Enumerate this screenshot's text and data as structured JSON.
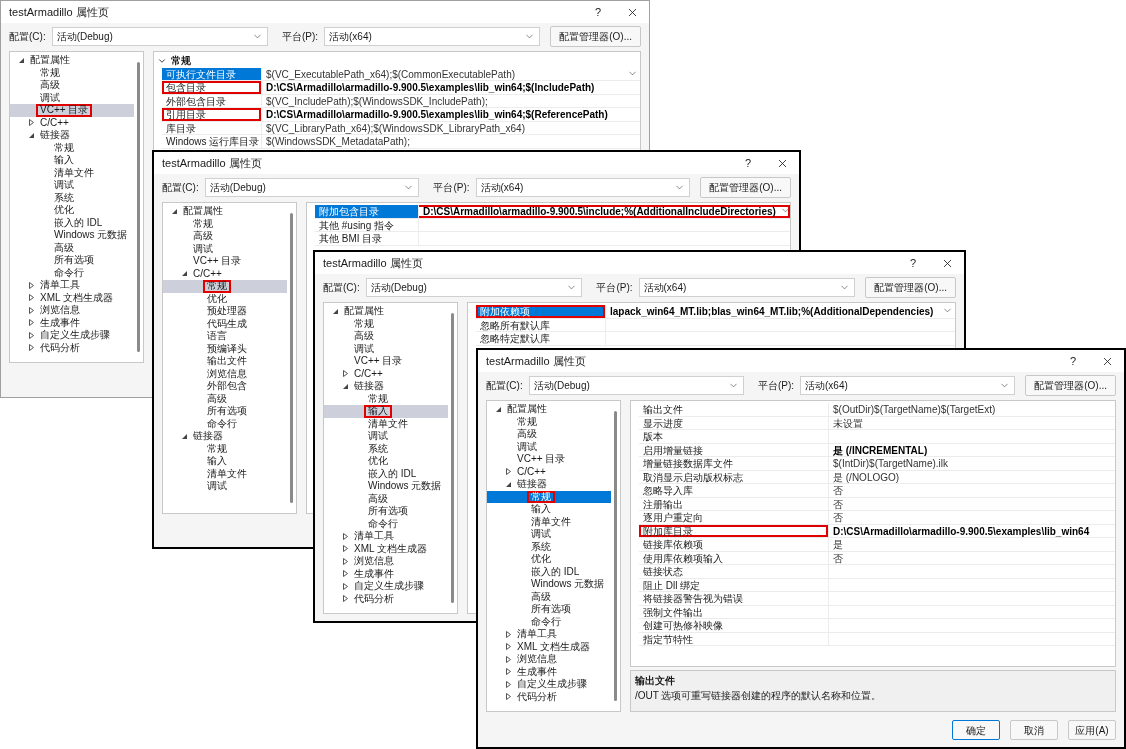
{
  "windows": [
    {
      "title": "testArmadillo 属性页",
      "help": "?",
      "active": false,
      "config_label": "配置(C):",
      "config_value": "活动(Debug)",
      "platform_label": "平台(P):",
      "platform_value": "活动(x64)",
      "manager_button": "配置管理器(O)...",
      "tree": [
        {
          "label": "配置属性",
          "expanded": true,
          "selected": false,
          "highlighted": false,
          "children": [
            {
              "label": "常规",
              "selected": false,
              "highlighted": false
            },
            {
              "label": "高级",
              "selected": false,
              "highlighted": false
            },
            {
              "label": "调试",
              "selected": false,
              "highlighted": false
            },
            {
              "label": "VC++ 目录",
              "selected": true,
              "highlighted": true
            },
            {
              "label": "C/C++",
              "expanded": false,
              "selected": false,
              "highlighted": false
            },
            {
              "label": "链接器",
              "expanded": true,
              "selected": false,
              "highlighted": false,
              "children": [
                {
                  "label": "常规",
                  "selected": false,
                  "highlighted": false
                },
                {
                  "label": "输入",
                  "selected": false,
                  "highlighted": false
                },
                {
                  "label": "清单文件",
                  "selected": false,
                  "highlighted": false
                },
                {
                  "label": "调试",
                  "selected": false,
                  "highlighted": false
                },
                {
                  "label": "系统",
                  "selected": false,
                  "highlighted": false
                },
                {
                  "label": "优化",
                  "selected": false,
                  "highlighted": false
                },
                {
                  "label": "嵌入的 IDL",
                  "selected": false,
                  "highlighted": false
                },
                {
                  "label": "Windows 元数据",
                  "selected": false,
                  "highlighted": false
                },
                {
                  "label": "高级",
                  "selected": false,
                  "highlighted": false
                },
                {
                  "label": "所有选项",
                  "selected": false,
                  "highlighted": false
                },
                {
                  "label": "命令行",
                  "selected": false,
                  "highlighted": false
                }
              ]
            },
            {
              "label": "清单工具",
              "expanded": false,
              "selected": false,
              "highlighted": false
            },
            {
              "label": "XML 文档生成器",
              "expanded": false,
              "selected": false,
              "highlighted": false
            },
            {
              "label": "浏览信息",
              "expanded": false,
              "selected": false,
              "highlighted": false
            },
            {
              "label": "生成事件",
              "expanded": false,
              "selected": false,
              "highlighted": false
            },
            {
              "label": "自定义生成步骤",
              "expanded": false,
              "selected": false,
              "highlighted": false
            },
            {
              "label": "代码分析",
              "expanded": false,
              "selected": false,
              "highlighted": false
            }
          ]
        }
      ],
      "grid": {
        "group": {
          "label": "常规",
          "expanded": true
        },
        "rows": [
          {
            "name": "可执行文件目录",
            "value": "$(VC_ExecutablePath_x64);$(CommonExecutablePath)",
            "bold": false,
            "selected": true,
            "highlighted": false
          },
          {
            "name": "包含目录",
            "value": "D:\\CS\\Armadillo\\armadillo-9.900.5\\examples\\lib_win64;$(IncludePath)",
            "bold": true,
            "selected": false,
            "highlighted": true
          },
          {
            "name": "外部包含目录",
            "value": "$(VC_IncludePath);$(WindowsSDK_IncludePath);",
            "bold": false,
            "selected": false,
            "highlighted": false
          },
          {
            "name": "引用目录",
            "value": "D:\\CS\\Armadillo\\armadillo-9.900.5\\examples\\lib_win64;$(ReferencePath)",
            "bold": true,
            "selected": false,
            "highlighted": true
          },
          {
            "name": "库目录",
            "value": "$(VC_LibraryPath_x64);$(WindowsSDK_LibraryPath_x64)",
            "bold": false,
            "selected": false,
            "highlighted": false
          },
          {
            "name": "Windows 运行库目录",
            "value": "$(WindowsSDK_MetadataPath);",
            "bold": false,
            "selected": false,
            "highlighted": false
          }
        ]
      }
    },
    {
      "title": "testArmadillo 属性页",
      "help": "?",
      "active": false,
      "config_label": "配置(C):",
      "config_value": "活动(Debug)",
      "platform_label": "平台(P):",
      "platform_value": "活动(x64)",
      "manager_button": "配置管理器(O)...",
      "tree": [
        {
          "label": "配置属性",
          "expanded": true,
          "selected": false,
          "highlighted": false,
          "children": [
            {
              "label": "常规",
              "selected": false,
              "highlighted": false
            },
            {
              "label": "高级",
              "selected": false,
              "highlighted": false
            },
            {
              "label": "调试",
              "selected": false,
              "highlighted": false
            },
            {
              "label": "VC++ 目录",
              "selected": false,
              "highlighted": false
            },
            {
              "label": "C/C++",
              "expanded": true,
              "selected": false,
              "highlighted": false,
              "children": [
                {
                  "label": "常规",
                  "selected": true,
                  "highlighted": true
                },
                {
                  "label": "优化",
                  "selected": false,
                  "highlighted": false
                },
                {
                  "label": "预处理器",
                  "selected": false,
                  "highlighted": false
                },
                {
                  "label": "代码生成",
                  "selected": false,
                  "highlighted": false
                },
                {
                  "label": "语言",
                  "selected": false,
                  "highlighted": false
                },
                {
                  "label": "预编译头",
                  "selected": false,
                  "highlighted": false
                },
                {
                  "label": "输出文件",
                  "selected": false,
                  "highlighted": false
                },
                {
                  "label": "浏览信息",
                  "selected": false,
                  "highlighted": false
                },
                {
                  "label": "外部包含",
                  "selected": false,
                  "highlighted": false
                },
                {
                  "label": "高级",
                  "selected": false,
                  "highlighted": false
                },
                {
                  "label": "所有选项",
                  "selected": false,
                  "highlighted": false
                },
                {
                  "label": "命令行",
                  "selected": false,
                  "highlighted": false
                }
              ]
            },
            {
              "label": "链接器",
              "expanded": true,
              "selected": false,
              "highlighted": false,
              "children": [
                {
                  "label": "常规",
                  "selected": false,
                  "highlighted": false
                },
                {
                  "label": "输入",
                  "selected": false,
                  "highlighted": false
                },
                {
                  "label": "清单文件",
                  "selected": false,
                  "highlighted": false
                },
                {
                  "label": "调试",
                  "selected": false,
                  "highlighted": false
                }
              ]
            }
          ]
        }
      ],
      "grid": {
        "rows": [
          {
            "name": "附加包含目录",
            "value": "D:\\CS\\Armadillo\\armadillo-9.900.5\\include;%(AdditionalIncludeDirectories)",
            "bold": true,
            "selected": true,
            "highlighted": true,
            "value_highlighted": true
          },
          {
            "name": "其他 #using 指令",
            "selected": false,
            "highlighted": false,
            "value_highlighted": false
          },
          {
            "name": "其他 BMI 目录",
            "selected": false,
            "highlighted": false,
            "value_highlighted": false
          }
        ]
      }
    },
    {
      "title": "testArmadillo 属性页",
      "help": "?",
      "active": false,
      "config_label": "配置(C):",
      "config_value": "活动(Debug)",
      "platform_label": "平台(P):",
      "platform_value": "活动(x64)",
      "manager_button": "配置管理器(O)...",
      "tree": [
        {
          "label": "配置属性",
          "expanded": true,
          "selected": false,
          "highlighted": false,
          "children": [
            {
              "label": "常规",
              "selected": false,
              "highlighted": false
            },
            {
              "label": "高级",
              "selected": false,
              "highlighted": false
            },
            {
              "label": "调试",
              "selected": false,
              "highlighted": false
            },
            {
              "label": "VC++ 目录",
              "selected": false,
              "highlighted": false
            },
            {
              "label": "C/C++",
              "expanded": false,
              "selected": false,
              "highlighted": false
            },
            {
              "label": "链接器",
              "expanded": true,
              "selected": false,
              "highlighted": false,
              "children": [
                {
                  "label": "常规",
                  "selected": false,
                  "highlighted": false
                },
                {
                  "label": "输入",
                  "selected": true,
                  "highlighted": true
                },
                {
                  "label": "清单文件",
                  "selected": false,
                  "highlighted": false
                },
                {
                  "label": "调试",
                  "selected": false,
                  "highlighted": false
                },
                {
                  "label": "系统",
                  "selected": false,
                  "highlighted": false
                },
                {
                  "label": "优化",
                  "selected": false,
                  "highlighted": false
                },
                {
                  "label": "嵌入的 IDL",
                  "selected": false,
                  "highlighted": false
                },
                {
                  "label": "Windows 元数据",
                  "selected": false,
                  "highlighted": false
                },
                {
                  "label": "高级",
                  "selected": false,
                  "highlighted": false
                },
                {
                  "label": "所有选项",
                  "selected": false,
                  "highlighted": false
                },
                {
                  "label": "命令行",
                  "selected": false,
                  "highlighted": false
                }
              ]
            },
            {
              "label": "清单工具",
              "expanded": false,
              "selected": false,
              "highlighted": false
            },
            {
              "label": "XML 文档生成器",
              "expanded": false,
              "selected": false,
              "highlighted": false
            },
            {
              "label": "浏览信息",
              "expanded": false,
              "selected": false,
              "highlighted": false
            },
            {
              "label": "生成事件",
              "expanded": false,
              "selected": false,
              "highlighted": false
            },
            {
              "label": "自定义生成步骤",
              "expanded": false,
              "selected": false,
              "highlighted": false
            },
            {
              "label": "代码分析",
              "expanded": false,
              "selected": false,
              "highlighted": false
            }
          ]
        }
      ],
      "grid": {
        "rows": [
          {
            "name": "附加依赖项",
            "value": "lapack_win64_MT.lib;blas_win64_MT.lib;%(AdditionalDependencies)",
            "bold": true,
            "selected": true,
            "highlighted": true
          },
          {
            "name": "忽略所有默认库",
            "selected": false,
            "highlighted": false
          },
          {
            "name": "忽略特定默认库",
            "selected": false,
            "highlighted": false
          }
        ]
      }
    },
    {
      "title": "testArmadillo 属性页",
      "help": "?",
      "active": true,
      "config_label": "配置(C):",
      "config_value": "活动(Debug)",
      "platform_label": "平台(P):",
      "platform_value": "活动(x64)",
      "manager_button": "配置管理器(O)...",
      "tree": [
        {
          "label": "配置属性",
          "expanded": true,
          "selected": false,
          "highlighted": false,
          "children": [
            {
              "label": "常规",
              "selected": false,
              "highlighted": false
            },
            {
              "label": "高级",
              "selected": false,
              "highlighted": false
            },
            {
              "label": "调试",
              "selected": false,
              "highlighted": false
            },
            {
              "label": "VC++ 目录",
              "selected": false,
              "highlighted": false
            },
            {
              "label": "C/C++",
              "expanded": false,
              "selected": false,
              "highlighted": false
            },
            {
              "label": "链接器",
              "expanded": true,
              "selected": false,
              "highlighted": false,
              "children": [
                {
                  "label": "常规",
                  "selected": true,
                  "highlighted": true
                },
                {
                  "label": "输入",
                  "selected": false,
                  "highlighted": false
                },
                {
                  "label": "清单文件",
                  "selected": false,
                  "highlighted": false
                },
                {
                  "label": "调试",
                  "selected": false,
                  "highlighted": false
                },
                {
                  "label": "系统",
                  "selected": false,
                  "highlighted": false
                },
                {
                  "label": "优化",
                  "selected": false,
                  "highlighted": false
                },
                {
                  "label": "嵌入的 IDL",
                  "selected": false,
                  "highlighted": false
                },
                {
                  "label": "Windows 元数据",
                  "selected": false,
                  "highlighted": false
                },
                {
                  "label": "高级",
                  "selected": false,
                  "highlighted": false
                },
                {
                  "label": "所有选项",
                  "selected": false,
                  "highlighted": false
                },
                {
                  "label": "命令行",
                  "selected": false,
                  "highlighted": false
                }
              ]
            },
            {
              "label": "清单工具",
              "expanded": false,
              "selected": false,
              "highlighted": false
            },
            {
              "label": "XML 文档生成器",
              "expanded": false,
              "selected": false,
              "highlighted": false
            },
            {
              "label": "浏览信息",
              "expanded": false,
              "selected": false,
              "highlighted": false
            },
            {
              "label": "生成事件",
              "expanded": false,
              "selected": false,
              "highlighted": false
            },
            {
              "label": "自定义生成步骤",
              "expanded": false,
              "selected": false,
              "highlighted": false
            },
            {
              "label": "代码分析",
              "expanded": false,
              "selected": false,
              "highlighted": false
            }
          ]
        }
      ],
      "grid": {
        "rows": [
          {
            "name": "输出文件",
            "value": "$(OutDir)$(TargetName)$(TargetExt)",
            "bold": false,
            "selected": false,
            "highlighted": false
          },
          {
            "name": "显示进度",
            "value": "未设置",
            "bold": false,
            "selected": false,
            "highlighted": false
          },
          {
            "name": "版本",
            "selected": false,
            "highlighted": false
          },
          {
            "name": "启用增量链接",
            "value": "是 (/INCREMENTAL)",
            "bold": true,
            "selected": false,
            "highlighted": false
          },
          {
            "name": "增量链接数据库文件",
            "value": "$(IntDir)$(TargetName).ilk",
            "bold": false,
            "selected": false,
            "highlighted": false
          },
          {
            "name": "取消显示启动版权标志",
            "value": "是 (/NOLOGO)",
            "bold": false,
            "selected": false,
            "highlighted": false
          },
          {
            "name": "忽略导入库",
            "value": "否",
            "bold": false,
            "selected": false,
            "highlighted": false
          },
          {
            "name": "注册输出",
            "value": "否",
            "bold": false,
            "selected": false,
            "highlighted": false
          },
          {
            "name": "逐用户重定向",
            "value": "否",
            "bold": false,
            "selected": false,
            "highlighted": false
          },
          {
            "name": "附加库目录",
            "value": "D:\\CS\\Armadillo\\armadillo-9.900.5\\examples\\lib_win64",
            "bold": true,
            "selected": false,
            "highlighted": true
          },
          {
            "name": "链接库依赖项",
            "value": "是",
            "bold": false,
            "selected": false,
            "highlighted": false
          },
          {
            "name": "使用库依赖项输入",
            "value": "否",
            "bold": false,
            "selected": false,
            "highlighted": false
          },
          {
            "name": "链接状态",
            "selected": false,
            "highlighted": false
          },
          {
            "name": "阻止 Dll 绑定",
            "selected": false,
            "highlighted": false
          },
          {
            "name": "将链接器警告视为错误",
            "selected": false,
            "highlighted": false
          },
          {
            "name": "强制文件输出",
            "selected": false,
            "highlighted": false
          },
          {
            "name": "创建可热修补映像",
            "selected": false,
            "highlighted": false
          },
          {
            "name": "指定节特性",
            "selected": false,
            "highlighted": false
          }
        ]
      },
      "description": {
        "title": "输出文件",
        "text": "/OUT 选项可重写链接器创建的程序的默认名称和位置。"
      },
      "buttons": [
        {
          "label": "确定",
          "default": true
        },
        {
          "label": "取消",
          "default": false
        },
        {
          "label": "应用(A)",
          "default": false
        }
      ]
    }
  ]
}
